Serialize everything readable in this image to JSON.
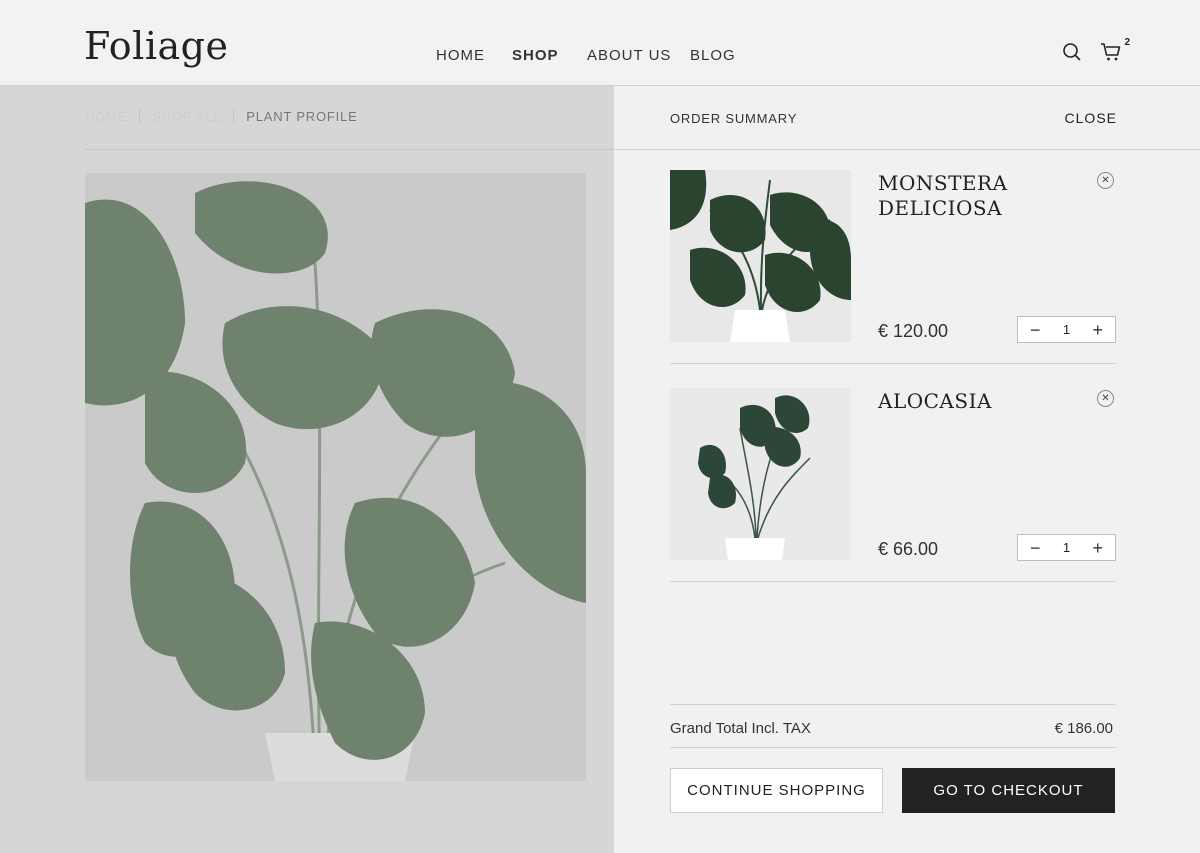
{
  "brand": {
    "logo": "Foliage"
  },
  "nav": {
    "items": [
      "HOME",
      "SHOP",
      "ABOUT US",
      "BLOG"
    ],
    "active": "SHOP"
  },
  "header": {
    "cart_count": "2",
    "icons": [
      "search-icon",
      "cart-icon"
    ]
  },
  "breadcrumbs": [
    "HOME",
    "SHOP ALL",
    "PLANT PROFILE"
  ],
  "drawer": {
    "title": "ORDER SUMMARY",
    "close": "CLOSE",
    "items": [
      {
        "name": "MONSTERA DELICIOSA",
        "price": "€ 120.00",
        "qty": "1"
      },
      {
        "name": "ALOCASIA",
        "price": "€ 66.00",
        "qty": "1"
      }
    ],
    "total_label": "Grand Total Incl. TAX",
    "total_value": "€ 186.00",
    "continue_label": "CONTINUE SHOPPING",
    "checkout_label": "GO TO CHECKOUT"
  },
  "colors": {
    "checkout_bg": "#222222",
    "overlay": "#d6d6d6",
    "leaf": "#4f6a4f"
  }
}
